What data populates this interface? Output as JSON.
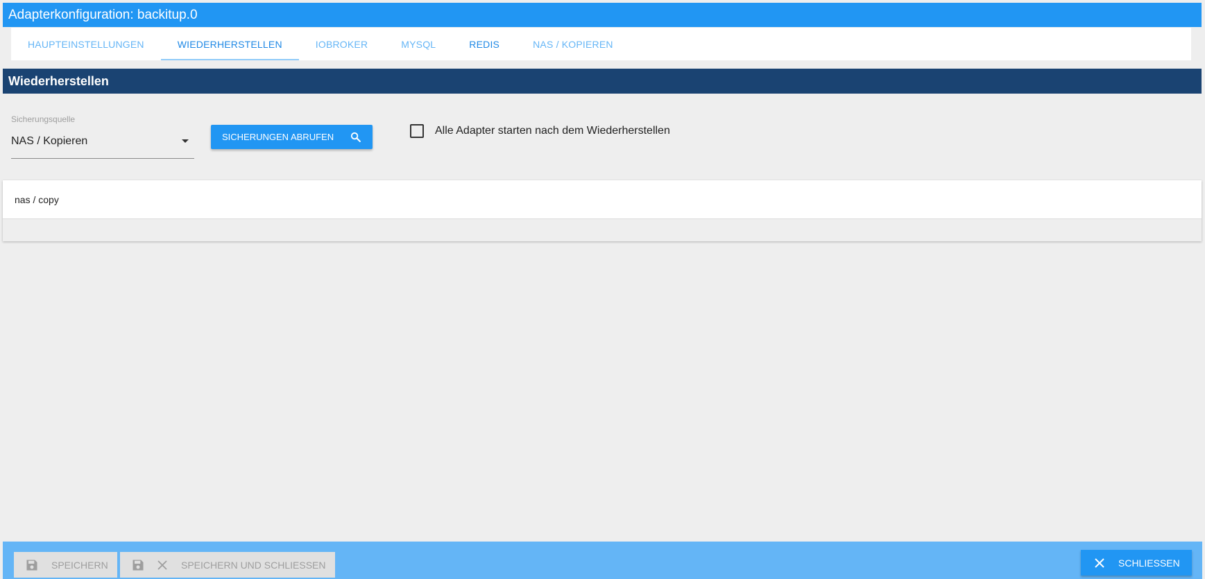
{
  "window": {
    "title": "Adapterkonfiguration: backitup.0"
  },
  "tabs": [
    {
      "label": "HAUPTEINSTELLUNGEN"
    },
    {
      "label": "WIEDERHERSTELLEN"
    },
    {
      "label": "IOBROKER"
    },
    {
      "label": "MYSQL"
    },
    {
      "label": "REDIS"
    },
    {
      "label": "NAS / KOPIEREN"
    }
  ],
  "section": {
    "title": "Wiederherstellen"
  },
  "source_select": {
    "label": "Sicherungsquelle",
    "value": "NAS / Kopieren"
  },
  "fetch_button": {
    "label": "SICHERUNGEN ABRUFEN",
    "icon": "search-icon"
  },
  "restart_checkbox": {
    "label": "Alle Adapter starten nach dem Wiederherstellen",
    "checked": false
  },
  "backup_panel": {
    "title": "nas / copy"
  },
  "footer": {
    "save_label": "SPEICHERN",
    "save_close_label": "SPEICHERN UND SCHLIESSEN",
    "close_label": "SCHLIESSEN"
  },
  "colors": {
    "primary": "#2196f3",
    "section_header": "#1a4372",
    "footer_bar": "#64b5f6"
  }
}
